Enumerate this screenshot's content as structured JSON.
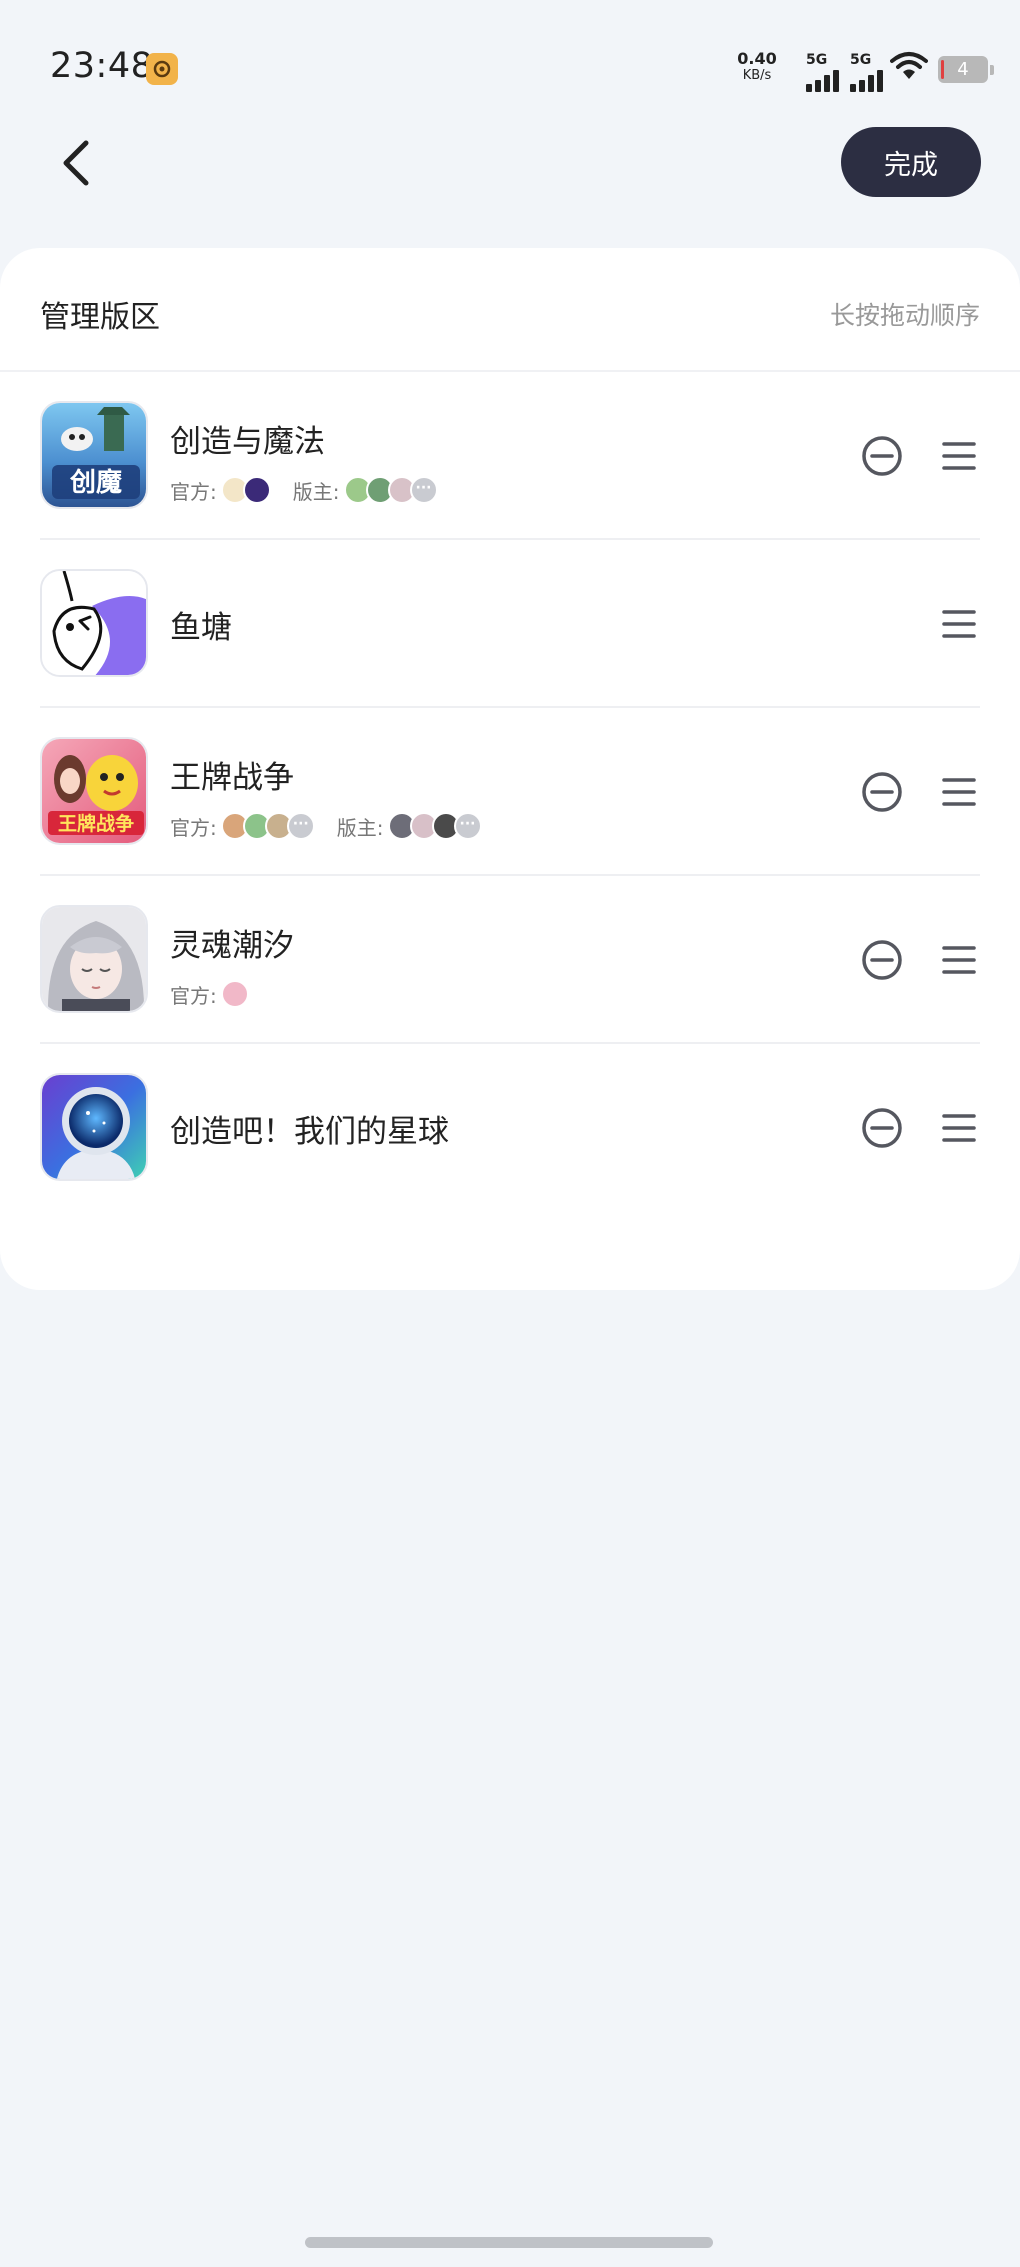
{
  "status_bar": {
    "time": "23:48",
    "net_speed_value": "0.40",
    "net_speed_unit": "KB/s",
    "signal1": "5G",
    "signal2": "5G",
    "battery": "4"
  },
  "header": {
    "done_label": "完成"
  },
  "card": {
    "title": "管理版区",
    "hint": "长按拖动顺序"
  },
  "forums": [
    {
      "name": "创造与魔法",
      "official_label": "官方:",
      "moderator_label": "版主:",
      "official_avatar_count": 2,
      "moderator_avatar_count": 3,
      "removable": true
    },
    {
      "name": "鱼塘",
      "removable": false
    },
    {
      "name": "王牌战争",
      "official_label": "官方:",
      "moderator_label": "版主:",
      "removable": true
    },
    {
      "name": "灵魂潮汐",
      "official_label": "官方:",
      "removable": true
    },
    {
      "name": "创造吧！我们的星球",
      "removable": true
    }
  ],
  "colors": {
    "page_bg": "#f2f5f9",
    "done_button_bg": "#2c2e42",
    "hint_text": "#999999"
  },
  "icons": [
    "back-arrow-icon",
    "remove-circle-icon",
    "drag-handle-icon"
  ]
}
